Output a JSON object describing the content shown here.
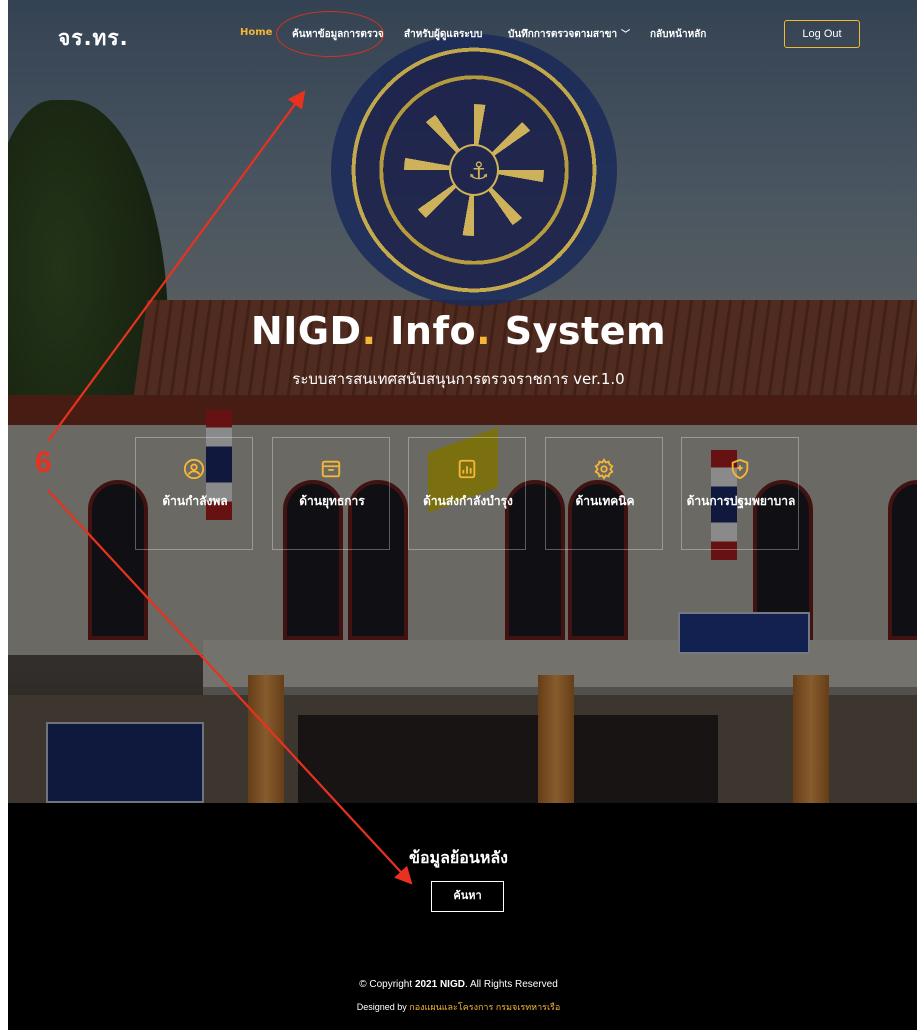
{
  "nav": {
    "brand": "จร.ทร.",
    "items": [
      {
        "label": "Home",
        "active": true
      },
      {
        "label": "ค้นหาข้อมูลการตรวจ",
        "active": false
      },
      {
        "label": "สำหรับผู้ดูแลระบบ",
        "active": false
      },
      {
        "label": "บันทึกการตรวจตามสาขา",
        "active": false,
        "dropdown": true
      },
      {
        "label": "กลับหน้าหลัก",
        "active": false
      }
    ],
    "logout": "Log Out"
  },
  "hero": {
    "title_part1": "NIGD",
    "title_part2": "Info",
    "title_part3": "System",
    "dot": ".",
    "subtitle": "ระบบสารสนเทศสนับสนุนการตรวจราชการ ver.1.0"
  },
  "cards": [
    {
      "label": "ด้านกำลังพล",
      "icon": "person-circle-icon"
    },
    {
      "label": "ด้านยุทธการ",
      "icon": "archive-box-icon"
    },
    {
      "label": "ด้านส่งกำลังบำรุง",
      "icon": "chart-bars-icon"
    },
    {
      "label": "ด้านเทคนิค",
      "icon": "gear-icon"
    },
    {
      "label": "ด้านการปฐมพยาบาล",
      "icon": "shield-plus-icon"
    }
  ],
  "history": {
    "title": "ข้อมูลย้อนหลัง",
    "button": "ค้นหา"
  },
  "footer": {
    "copyright_prefix": "© Copyright ",
    "copyright_brand": "2021 NIGD",
    "copyright_suffix": ". All Rights Reserved",
    "designed_prefix": "Designed by ",
    "designed_org": "กองแผนและโครงการ กรมจเรทหารเรือ"
  },
  "annotation": {
    "number": "6"
  },
  "colors": {
    "accent": "#f6b734",
    "annotation": "#e8321f",
    "footer_bg": "#000000"
  }
}
